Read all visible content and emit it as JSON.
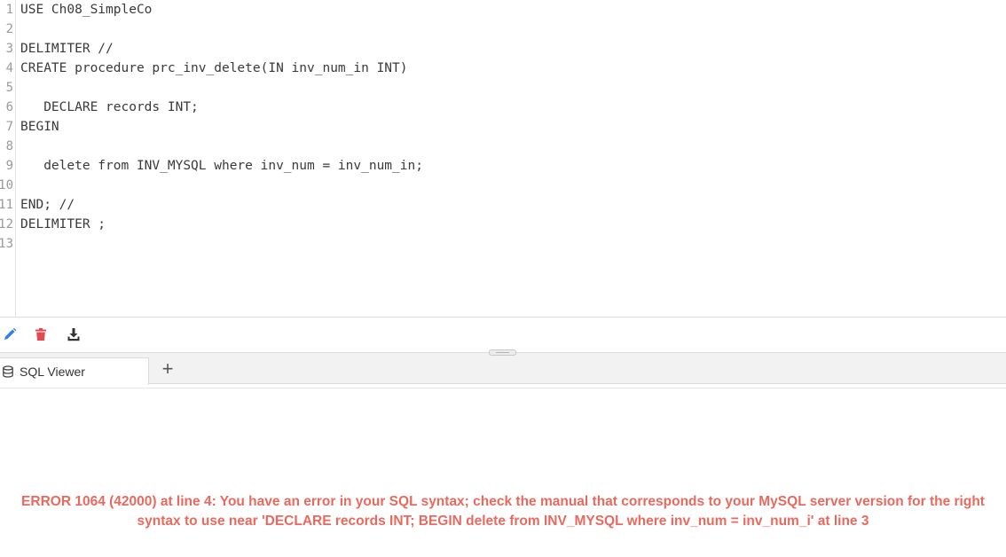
{
  "editor": {
    "line_numbers": [
      "1",
      "2",
      "3",
      "4",
      "5",
      "6",
      "7",
      "8",
      "9",
      "10",
      "11",
      "12",
      "13"
    ],
    "lines": [
      "USE Ch08_SimpleCo",
      "",
      "DELIMITER //",
      "CREATE procedure prc_inv_delete(IN inv_num_in INT)",
      "",
      "   DECLARE records INT;",
      "BEGIN",
      "",
      "   delete from INV_MYSQL where inv_num = inv_num_in;",
      "",
      "END; //",
      "DELIMITER ;",
      ""
    ]
  },
  "toolbar": {
    "edit_icon": "pencil-icon",
    "delete_icon": "trash-icon",
    "download_icon": "download-icon",
    "colors": {
      "edit": "#2f80ed",
      "delete": "#e5484d",
      "download": "#333333"
    }
  },
  "tabs": [
    {
      "label": "SQL Viewer",
      "icon": "database-icon"
    }
  ],
  "add_tab_label": "+",
  "result": {
    "error_line1": "ERROR 1064 (42000) at line 4: You have an error in your SQL syntax; check the manual that corresponds to your MySQL server version for the right",
    "error_line2": "syntax to use near 'DECLARE records INT; BEGIN delete from INV_MYSQL where inv_num = inv_num_i' at line 3",
    "color": "#e86a5f"
  }
}
